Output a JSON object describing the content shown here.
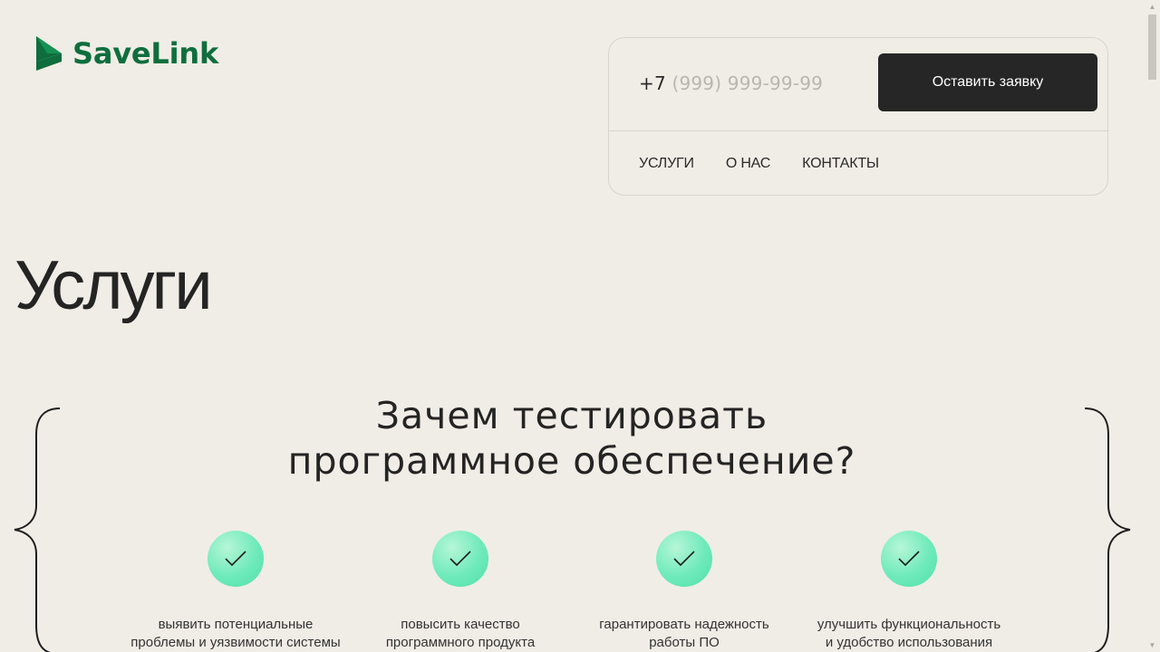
{
  "brand": {
    "name": "SaveLink",
    "color": "#0e6e3d"
  },
  "header": {
    "phone_prefix": "+7",
    "phone_placeholder": "(999) 999-99-99",
    "request_button": "Оставить заявку",
    "nav": [
      "УСЛУГИ",
      "О НАС",
      "КОНТАКТЫ"
    ]
  },
  "page": {
    "title": "Услуги"
  },
  "section": {
    "heading_line1": "Зачем тестировать",
    "heading_line2": "программное обеспечение?",
    "features": [
      {
        "line1": "выявить потенциальные",
        "line2": "проблемы и уязвимости системы",
        "icon": "check-icon"
      },
      {
        "line1": "повысить качество",
        "line2": "программного продукта",
        "icon": "check-icon"
      },
      {
        "line1": "гарантировать надежность",
        "line2": "работы ПО",
        "icon": "check-icon"
      },
      {
        "line1": "улучшить функциональность",
        "line2": "и удобство использования",
        "icon": "check-icon"
      }
    ]
  },
  "colors": {
    "background": "#f0ede6",
    "button": "#262626",
    "accent_green": "#4fe0a8"
  }
}
